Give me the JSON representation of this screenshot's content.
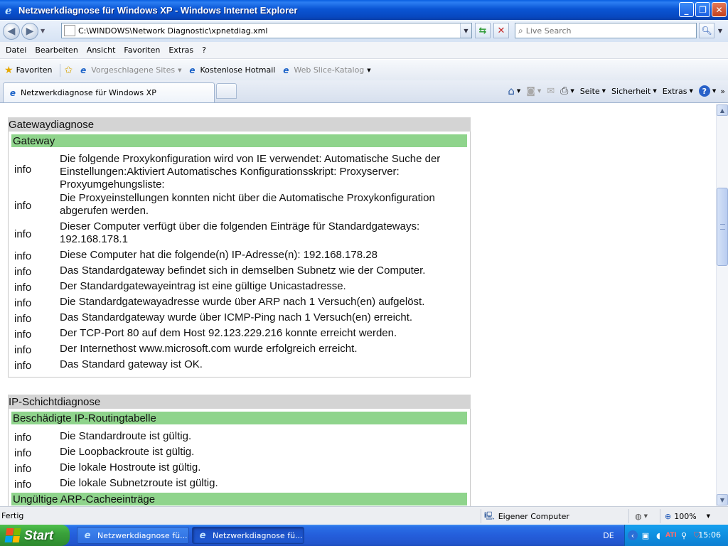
{
  "window": {
    "title": "Netzwerkdiagnose für Windows XP - Windows Internet Explorer",
    "min_label": "_",
    "max_label": "❐",
    "close_label": "✕"
  },
  "address": {
    "url": "C:\\WINDOWS\\Network Diagnostic\\xpnetdiag.xml",
    "search_placeholder": "Live Search"
  },
  "menu": [
    "Datei",
    "Bearbeiten",
    "Ansicht",
    "Favoriten",
    "Extras",
    "?"
  ],
  "favorites": {
    "favorites_label": "Favoriten",
    "links": [
      {
        "label": "Vorgeschlagene Sites",
        "has_dropdown": true,
        "disabled": true
      },
      {
        "label": "Kostenlose Hotmail",
        "has_dropdown": false,
        "disabled": false
      },
      {
        "label": "Web Slice-Katalog",
        "has_dropdown": true,
        "disabled": true
      }
    ]
  },
  "tab": {
    "label": "Netzwerkdiagnose für Windows XP"
  },
  "commands": {
    "page": "Seite",
    "security": "Sicherheit",
    "tools": "Extras",
    "help": "?",
    "more": "»"
  },
  "sections": [
    {
      "title": "Gatewaydiagnose",
      "groups": [
        {
          "title": "Gateway",
          "rows": [
            {
              "level": "info",
              "message": "Die folgende Proxykonfiguration wird von IE verwendet: Automatische Suche der Einstellungen:Aktiviert Automatisches Konfigurationsskript: Proxyserver: Proxyumgehungsliste:"
            },
            {
              "level": "info",
              "message": "Die Proxyeinstellungen konnten nicht über die Automatische Proxykonfiguration abgerufen werden."
            },
            {
              "level": "info",
              "message": "Dieser Computer verfügt über die folgenden Einträge für Standardgateways: 192.168.178.1"
            },
            {
              "level": "info",
              "message": "Diese Computer hat die folgende(n) IP-Adresse(n): 192.168.178.28"
            },
            {
              "level": "info",
              "message": "Das Standardgateway befindet sich in demselben Subnetz wie der Computer."
            },
            {
              "level": "info",
              "message": "Der Standardgatewayeintrag ist eine gültige Unicastadresse."
            },
            {
              "level": "info",
              "message": "Die Standardgatewayadresse wurde über ARP nach 1 Versuch(en) aufgelöst."
            },
            {
              "level": "info",
              "message": "Das Standardgateway wurde über ICMP-Ping nach 1 Versuch(en) erreicht."
            },
            {
              "level": "info",
              "message": "Der TCP-Port 80 auf dem Host 92.123.229.216 konnte erreicht werden."
            },
            {
              "level": "info",
              "message": "Der Internethost www.microsoft.com wurde erfolgreich erreicht."
            },
            {
              "level": "info",
              "message": "Das Standard gateway ist OK."
            }
          ]
        }
      ]
    },
    {
      "title": "IP-Schichtdiagnose",
      "groups": [
        {
          "title": "Beschädigte IP-Routingtabelle",
          "rows": [
            {
              "level": "info",
              "message": "Die Standardroute ist gültig."
            },
            {
              "level": "info",
              "message": "Die Loopbackroute ist gültig."
            },
            {
              "level": "info",
              "message": "Die lokale Hostroute ist gültig."
            },
            {
              "level": "info",
              "message": "Die lokale Subnetzroute ist gültig."
            }
          ]
        },
        {
          "title": "Ungültige ARP-Cacheeinträge",
          "rows": []
        }
      ]
    }
  ],
  "status": {
    "text": "Fertig",
    "zone": "Eigener Computer",
    "zoom": "100%"
  },
  "taskbar": {
    "start_label": "Start",
    "items": [
      "Netzwerkdiagnose fü...",
      "Netzwerkdiagnose fü..."
    ],
    "language": "DE",
    "clock": "15:06"
  },
  "colors": {
    "section_header": "#d4d4d4",
    "group_header": "#8fd48c",
    "titlebar": "#0a55d4",
    "taskbar": "#245edb",
    "start_button": "#3aa23b"
  }
}
